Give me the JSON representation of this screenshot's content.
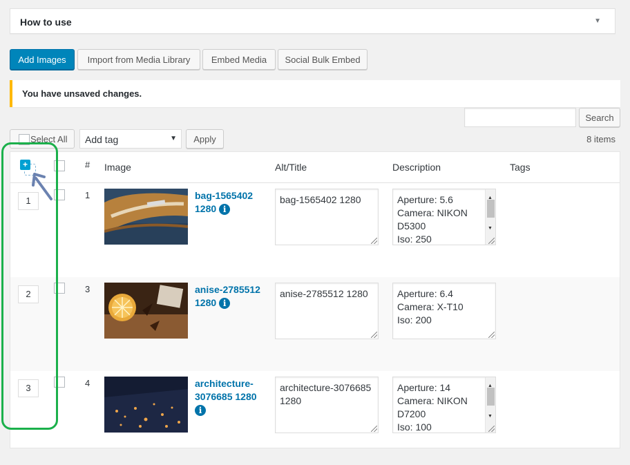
{
  "how_to_use": {
    "title": "How to use"
  },
  "buttons": {
    "add_images": "Add Images",
    "import_media": "Import from Media Library",
    "embed_media": "Embed Media",
    "social_bulk_embed": "Social Bulk Embed"
  },
  "notice": {
    "text": "You have unsaved changes."
  },
  "search": {
    "value": "",
    "button": "Search"
  },
  "toolbar": {
    "select_all": "Select All",
    "tag_select": "Add tag",
    "apply": "Apply",
    "item_count": "8 items"
  },
  "columns": {
    "num": "#",
    "image": "Image",
    "alt": "Alt/Title",
    "description": "Description",
    "tags": "Tags"
  },
  "rows": [
    {
      "order": "1",
      "num": "1",
      "title_line1": "bag-1565402",
      "title_line2": "1280",
      "alt": "bag-1565402 1280",
      "description": "Aperture: 5.6\nCamera: NIKON\nD5300\nIso: 250"
    },
    {
      "order": "2",
      "num": "3",
      "title_line1": "anise-2785512",
      "title_line2": "1280",
      "alt": "anise-2785512 1280",
      "description": "Aperture: 6.4\nCamera: X-T10\nIso: 200"
    },
    {
      "order": "3",
      "num": "4",
      "title_line1": "architecture-",
      "title_line2": "3076685 1280",
      "alt": "architecture-3076685\n1280",
      "description": "Aperture: 14\nCamera: NIKON\nD7200\nIso: 100"
    }
  ],
  "colors": {
    "primary": "#0085ba",
    "link": "#0073aa",
    "highlight": "#1bb04b",
    "notice": "#ffb900"
  },
  "icons": {
    "drag": "plus-icon",
    "info": "info-icon",
    "arrow": "pointer-arrow-icon"
  }
}
